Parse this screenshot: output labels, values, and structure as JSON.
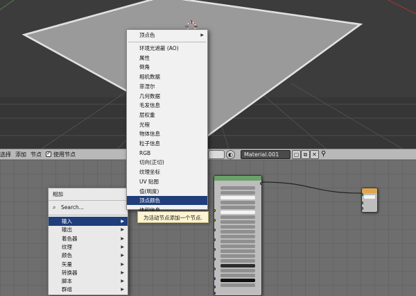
{
  "node_header": {
    "select_label": "选择",
    "add_label": "添加",
    "node_label": "节点",
    "use_nodes_label": "使用节点",
    "material_name": "Material.001"
  },
  "input_menu": {
    "header": "顶点色",
    "items": [
      "环境光遮蔽 (AO)",
      "属性",
      "倒角",
      "相机数据",
      "菲涅尔",
      "几何数据",
      "毛发信息",
      "层权重",
      "光程",
      "物体信息",
      "粒子信息",
      "RGB",
      "切向(正切)",
      "纹理坐标",
      "UV 贴图",
      "值(明度)",
      "顶点颜色",
      "体积信息"
    ],
    "active_index": 16
  },
  "tooltip": {
    "text": "为活动节点添加一个节点."
  },
  "add_menu": {
    "title": "相加",
    "search_placeholder": "Search...",
    "items": [
      "输入",
      "输出",
      "着色器",
      "纹理",
      "颜色",
      "矢量",
      "转换器",
      "脚本",
      "群组"
    ],
    "active_index": 0
  },
  "colors": {
    "menu_highlight": "#1f3e7a",
    "tooltip_bg": "#fdf4d2",
    "socket_shader": "#63c763",
    "socket_color": "#c7c729",
    "socket_vector": "#6363c7",
    "socket_value": "#a1a1a1",
    "output_node_header": "#e0a64d"
  }
}
